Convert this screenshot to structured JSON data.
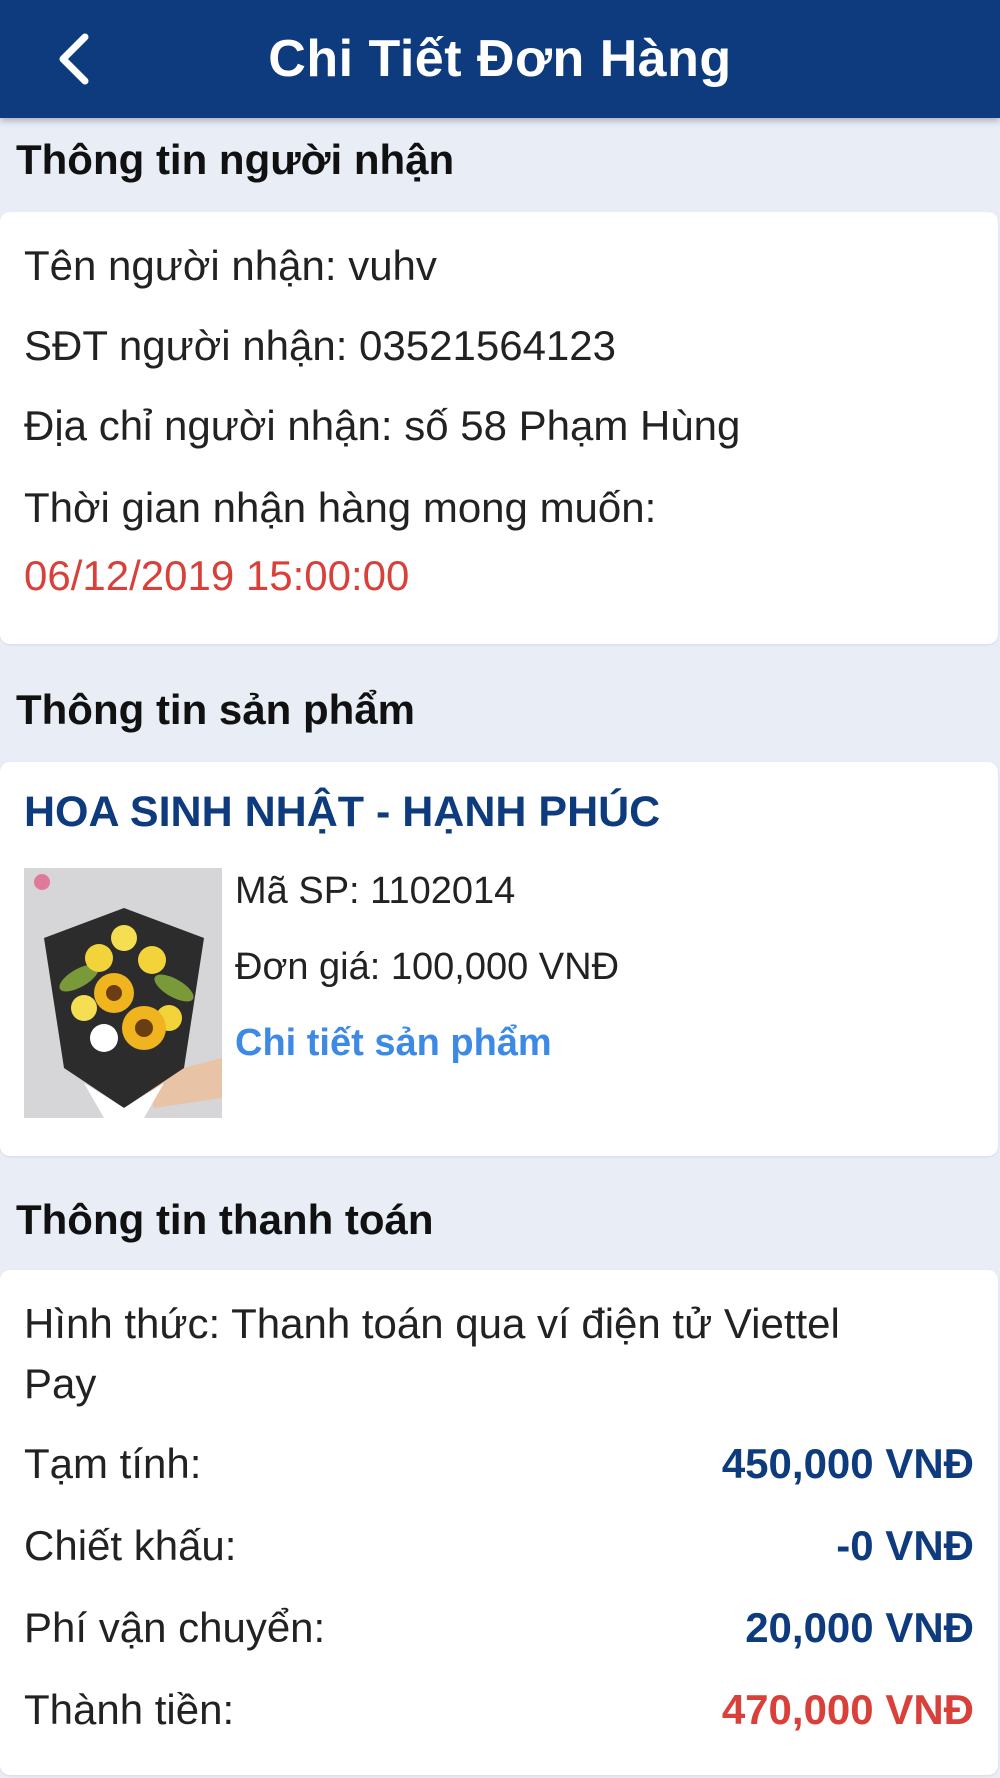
{
  "header": {
    "title": "Chi Tiết Đơn Hàng",
    "back_icon": "chevron-left-icon"
  },
  "recipient": {
    "section_title": "Thông tin người nhận",
    "name_label": "Tên người nhận: vuhv",
    "phone_label": "SĐT người nhận: 03521564123",
    "address_label": "Địa chỉ người nhận: số 58 Phạm Hùng",
    "delivery_time_label": "Thời gian nhận hàng mong muốn:",
    "delivery_time_value": "06/12/2019 15:00:00"
  },
  "product": {
    "section_title": "Thông tin sản phẩm",
    "name": "HOA SINH NHẬT - HẠNH PHÚC",
    "code_label": "Mã SP: 1102014",
    "price_label": "Đơn giá: 100,000 VNĐ",
    "detail_link": "Chi tiết sản phẩm"
  },
  "payment": {
    "section_title": "Thông tin thanh toán",
    "method_line1": "Hình thức: Thanh toán qua ví điện tử Viettel",
    "method_line2": "Pay",
    "subtotal_label": "Tạm tính:",
    "subtotal_value": "450,000 VNĐ",
    "discount_label": "Chiết khấu:",
    "discount_value": "-0 VNĐ",
    "shipping_label": "Phí vận chuyển:",
    "shipping_value": "20,000 VNĐ",
    "total_label": "Thành tiền:",
    "total_value": "470,000 VNĐ"
  },
  "colors": {
    "primary": "#0d3b7e",
    "accent_red": "#d9403a",
    "link_blue": "#3d8ae6",
    "background": "#e8edf6"
  }
}
